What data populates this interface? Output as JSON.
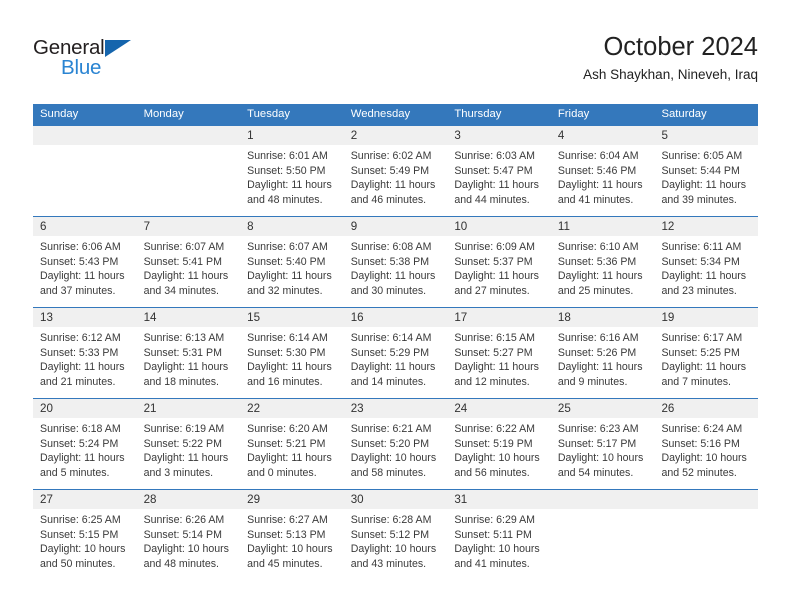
{
  "brand": {
    "line1": "General",
    "line2": "Blue",
    "triangle_icon": "triangle-icon",
    "color_dark": "#231f20",
    "color_blue": "#2a84d2"
  },
  "header": {
    "title": "October 2024",
    "subtitle": "Ash Shaykhan, Nineveh, Iraq"
  },
  "theme": {
    "header_bg": "#3478bc",
    "header_text": "#ffffff",
    "daynum_bg": "#f0f0f0",
    "cell_bg": "#ffffff",
    "body_text": "#3a3a3a"
  },
  "weekdays": [
    "Sunday",
    "Monday",
    "Tuesday",
    "Wednesday",
    "Thursday",
    "Friday",
    "Saturday"
  ],
  "weeks": [
    [
      {
        "day": "",
        "sunrise": "",
        "sunset": "",
        "daylight1": "",
        "daylight2": ""
      },
      {
        "day": "",
        "sunrise": "",
        "sunset": "",
        "daylight1": "",
        "daylight2": ""
      },
      {
        "day": "1",
        "sunrise": "Sunrise: 6:01 AM",
        "sunset": "Sunset: 5:50 PM",
        "daylight1": "Daylight: 11 hours",
        "daylight2": "and 48 minutes."
      },
      {
        "day": "2",
        "sunrise": "Sunrise: 6:02 AM",
        "sunset": "Sunset: 5:49 PM",
        "daylight1": "Daylight: 11 hours",
        "daylight2": "and 46 minutes."
      },
      {
        "day": "3",
        "sunrise": "Sunrise: 6:03 AM",
        "sunset": "Sunset: 5:47 PM",
        "daylight1": "Daylight: 11 hours",
        "daylight2": "and 44 minutes."
      },
      {
        "day": "4",
        "sunrise": "Sunrise: 6:04 AM",
        "sunset": "Sunset: 5:46 PM",
        "daylight1": "Daylight: 11 hours",
        "daylight2": "and 41 minutes."
      },
      {
        "day": "5",
        "sunrise": "Sunrise: 6:05 AM",
        "sunset": "Sunset: 5:44 PM",
        "daylight1": "Daylight: 11 hours",
        "daylight2": "and 39 minutes."
      }
    ],
    [
      {
        "day": "6",
        "sunrise": "Sunrise: 6:06 AM",
        "sunset": "Sunset: 5:43 PM",
        "daylight1": "Daylight: 11 hours",
        "daylight2": "and 37 minutes."
      },
      {
        "day": "7",
        "sunrise": "Sunrise: 6:07 AM",
        "sunset": "Sunset: 5:41 PM",
        "daylight1": "Daylight: 11 hours",
        "daylight2": "and 34 minutes."
      },
      {
        "day": "8",
        "sunrise": "Sunrise: 6:07 AM",
        "sunset": "Sunset: 5:40 PM",
        "daylight1": "Daylight: 11 hours",
        "daylight2": "and 32 minutes."
      },
      {
        "day": "9",
        "sunrise": "Sunrise: 6:08 AM",
        "sunset": "Sunset: 5:38 PM",
        "daylight1": "Daylight: 11 hours",
        "daylight2": "and 30 minutes."
      },
      {
        "day": "10",
        "sunrise": "Sunrise: 6:09 AM",
        "sunset": "Sunset: 5:37 PM",
        "daylight1": "Daylight: 11 hours",
        "daylight2": "and 27 minutes."
      },
      {
        "day": "11",
        "sunrise": "Sunrise: 6:10 AM",
        "sunset": "Sunset: 5:36 PM",
        "daylight1": "Daylight: 11 hours",
        "daylight2": "and 25 minutes."
      },
      {
        "day": "12",
        "sunrise": "Sunrise: 6:11 AM",
        "sunset": "Sunset: 5:34 PM",
        "daylight1": "Daylight: 11 hours",
        "daylight2": "and 23 minutes."
      }
    ],
    [
      {
        "day": "13",
        "sunrise": "Sunrise: 6:12 AM",
        "sunset": "Sunset: 5:33 PM",
        "daylight1": "Daylight: 11 hours",
        "daylight2": "and 21 minutes."
      },
      {
        "day": "14",
        "sunrise": "Sunrise: 6:13 AM",
        "sunset": "Sunset: 5:31 PM",
        "daylight1": "Daylight: 11 hours",
        "daylight2": "and 18 minutes."
      },
      {
        "day": "15",
        "sunrise": "Sunrise: 6:14 AM",
        "sunset": "Sunset: 5:30 PM",
        "daylight1": "Daylight: 11 hours",
        "daylight2": "and 16 minutes."
      },
      {
        "day": "16",
        "sunrise": "Sunrise: 6:14 AM",
        "sunset": "Sunset: 5:29 PM",
        "daylight1": "Daylight: 11 hours",
        "daylight2": "and 14 minutes."
      },
      {
        "day": "17",
        "sunrise": "Sunrise: 6:15 AM",
        "sunset": "Sunset: 5:27 PM",
        "daylight1": "Daylight: 11 hours",
        "daylight2": "and 12 minutes."
      },
      {
        "day": "18",
        "sunrise": "Sunrise: 6:16 AM",
        "sunset": "Sunset: 5:26 PM",
        "daylight1": "Daylight: 11 hours",
        "daylight2": "and 9 minutes."
      },
      {
        "day": "19",
        "sunrise": "Sunrise: 6:17 AM",
        "sunset": "Sunset: 5:25 PM",
        "daylight1": "Daylight: 11 hours",
        "daylight2": "and 7 minutes."
      }
    ],
    [
      {
        "day": "20",
        "sunrise": "Sunrise: 6:18 AM",
        "sunset": "Sunset: 5:24 PM",
        "daylight1": "Daylight: 11 hours",
        "daylight2": "and 5 minutes."
      },
      {
        "day": "21",
        "sunrise": "Sunrise: 6:19 AM",
        "sunset": "Sunset: 5:22 PM",
        "daylight1": "Daylight: 11 hours",
        "daylight2": "and 3 minutes."
      },
      {
        "day": "22",
        "sunrise": "Sunrise: 6:20 AM",
        "sunset": "Sunset: 5:21 PM",
        "daylight1": "Daylight: 11 hours",
        "daylight2": "and 0 minutes."
      },
      {
        "day": "23",
        "sunrise": "Sunrise: 6:21 AM",
        "sunset": "Sunset: 5:20 PM",
        "daylight1": "Daylight: 10 hours",
        "daylight2": "and 58 minutes."
      },
      {
        "day": "24",
        "sunrise": "Sunrise: 6:22 AM",
        "sunset": "Sunset: 5:19 PM",
        "daylight1": "Daylight: 10 hours",
        "daylight2": "and 56 minutes."
      },
      {
        "day": "25",
        "sunrise": "Sunrise: 6:23 AM",
        "sunset": "Sunset: 5:17 PM",
        "daylight1": "Daylight: 10 hours",
        "daylight2": "and 54 minutes."
      },
      {
        "day": "26",
        "sunrise": "Sunrise: 6:24 AM",
        "sunset": "Sunset: 5:16 PM",
        "daylight1": "Daylight: 10 hours",
        "daylight2": "and 52 minutes."
      }
    ],
    [
      {
        "day": "27",
        "sunrise": "Sunrise: 6:25 AM",
        "sunset": "Sunset: 5:15 PM",
        "daylight1": "Daylight: 10 hours",
        "daylight2": "and 50 minutes."
      },
      {
        "day": "28",
        "sunrise": "Sunrise: 6:26 AM",
        "sunset": "Sunset: 5:14 PM",
        "daylight1": "Daylight: 10 hours",
        "daylight2": "and 48 minutes."
      },
      {
        "day": "29",
        "sunrise": "Sunrise: 6:27 AM",
        "sunset": "Sunset: 5:13 PM",
        "daylight1": "Daylight: 10 hours",
        "daylight2": "and 45 minutes."
      },
      {
        "day": "30",
        "sunrise": "Sunrise: 6:28 AM",
        "sunset": "Sunset: 5:12 PM",
        "daylight1": "Daylight: 10 hours",
        "daylight2": "and 43 minutes."
      },
      {
        "day": "31",
        "sunrise": "Sunrise: 6:29 AM",
        "sunset": "Sunset: 5:11 PM",
        "daylight1": "Daylight: 10 hours",
        "daylight2": "and 41 minutes."
      },
      {
        "day": "",
        "sunrise": "",
        "sunset": "",
        "daylight1": "",
        "daylight2": ""
      },
      {
        "day": "",
        "sunrise": "",
        "sunset": "",
        "daylight1": "",
        "daylight2": ""
      }
    ]
  ]
}
